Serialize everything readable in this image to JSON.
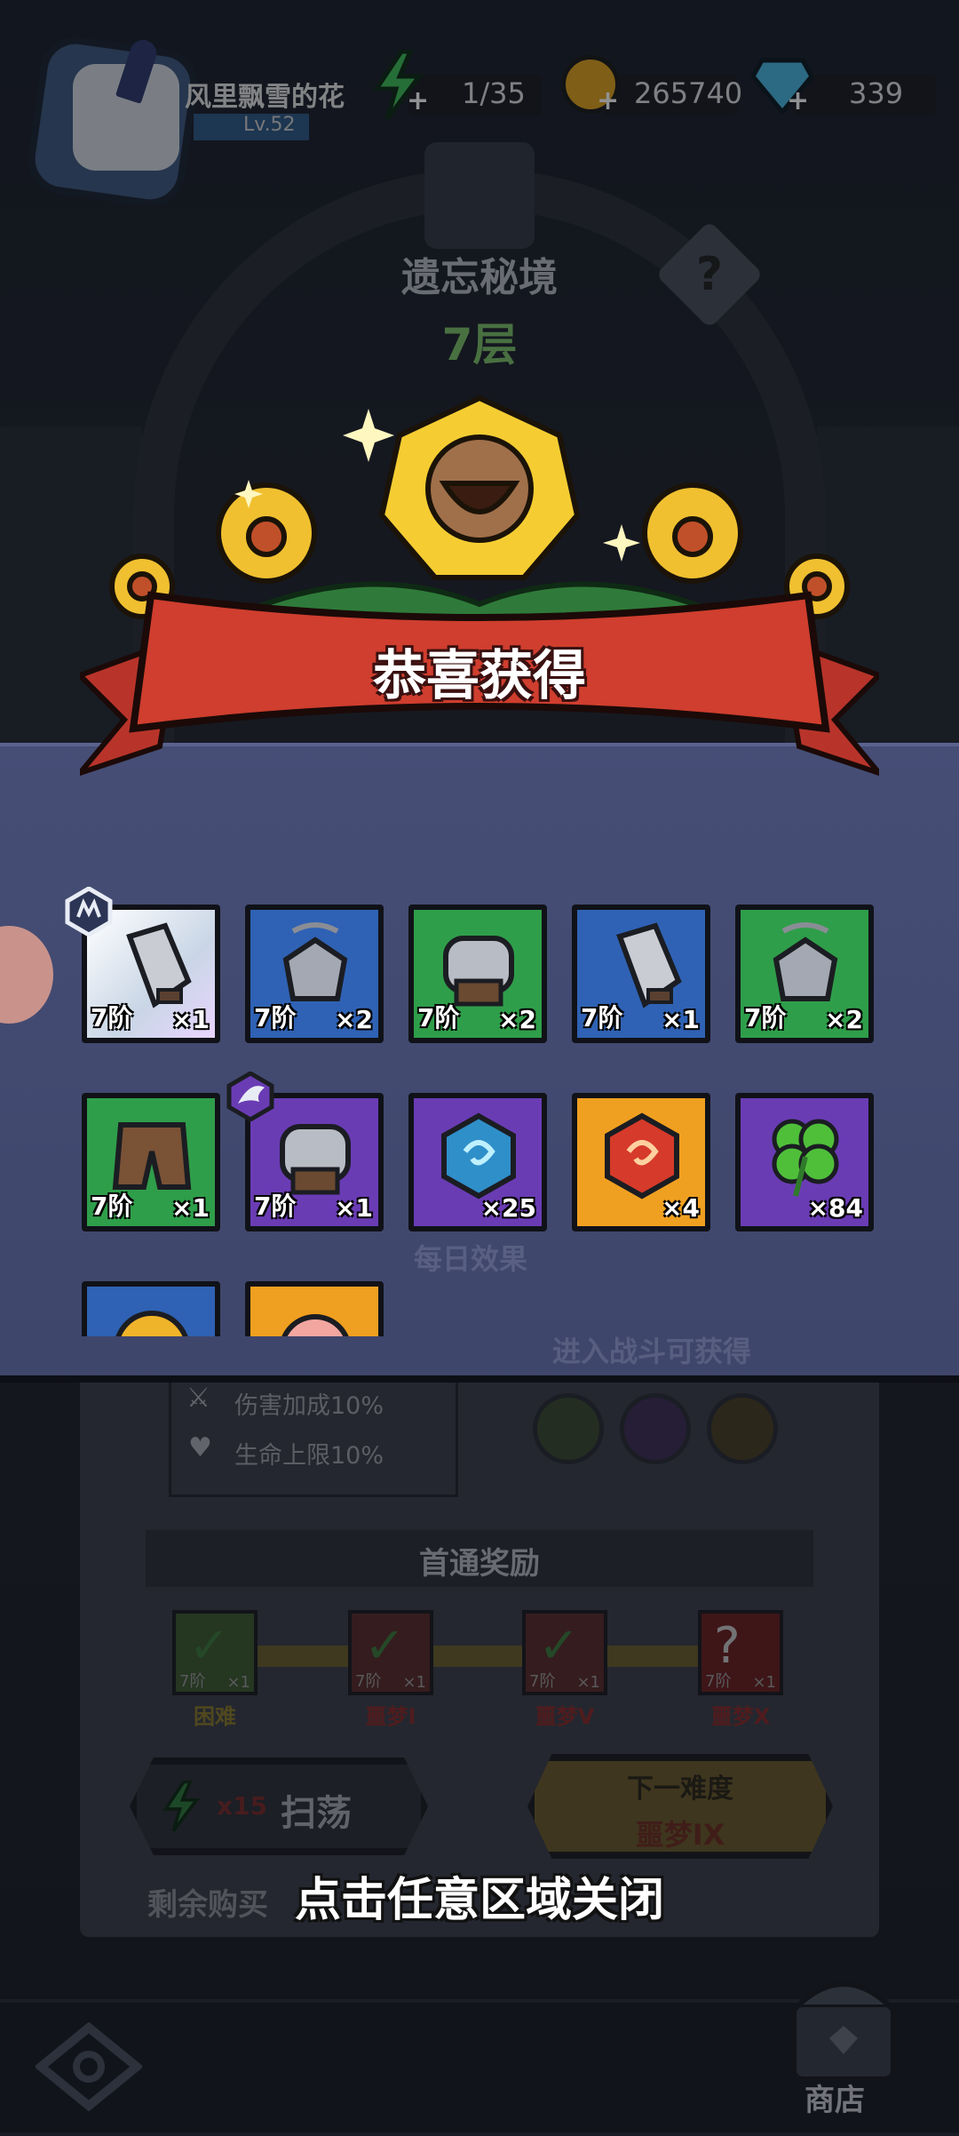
{
  "player": {
    "name": "风里飘雪的花",
    "level": "Lv.52"
  },
  "resources": {
    "energy": "1/35",
    "gold": "265740",
    "gems": "339"
  },
  "stage": {
    "title": "遗忘秘境",
    "floor": "7层",
    "help": "?"
  },
  "popup": {
    "title": "恭喜获得",
    "items": [
      {
        "icon": "sword-icon",
        "bg": "#d9e3ec",
        "tier": "7阶",
        "qty": "×1"
      },
      {
        "icon": "amulet-icon",
        "bg": "#2f62b4",
        "tier": "7阶",
        "qty": "×2"
      },
      {
        "icon": "armor-icon",
        "bg": "#2f9e4a",
        "tier": "7阶",
        "qty": "×2"
      },
      {
        "icon": "sword-icon",
        "bg": "#2f62b4",
        "tier": "7阶",
        "qty": "×1"
      },
      {
        "icon": "amulet-icon",
        "bg": "#2f9e4a",
        "tier": "7阶",
        "qty": "×2"
      },
      {
        "icon": "pants-icon",
        "bg": "#2f9e4a",
        "tier": "7阶",
        "qty": "×1"
      },
      {
        "icon": "armor-icon",
        "bg": "#6a3cb4",
        "tier": "7阶",
        "qty": "×1"
      },
      {
        "icon": "blue-gem-icon",
        "bg": "#6a3cb4",
        "tier": "",
        "qty": "×25"
      },
      {
        "icon": "red-gem-icon",
        "bg": "#f0a020",
        "tier": "",
        "qty": "×4"
      },
      {
        "icon": "clover-icon",
        "bg": "#6a3cb4",
        "tier": "",
        "qty": "×84"
      },
      {
        "icon": "coin-icon",
        "bg": "#2f62b4",
        "tier": "",
        "qty": ""
      },
      {
        "icon": "peach-icon",
        "bg": "#f0a020",
        "tier": "",
        "qty": ""
      }
    ],
    "close_hint": "点击任意区域关闭"
  },
  "background": {
    "daily_effect": "每日效果",
    "battle_unlock": "进入战斗可获得",
    "buff_damage": "伤害加成10%",
    "buff_hp": "生命上限10%",
    "first_clear": "首通奖励",
    "rewards": [
      {
        "label": "困难",
        "tier": "7阶",
        "qty": "×1",
        "color": "#8a7a2a",
        "nodebg": "#3c5a30"
      },
      {
        "label": "噩梦I",
        "tier": "7阶",
        "qty": "×1",
        "color": "#8a2a2a",
        "nodebg": "#5a2a2a"
      },
      {
        "label": "噩梦V",
        "tier": "7阶",
        "qty": "×1",
        "color": "#8a2a2a",
        "nodebg": "#5a2a2a"
      },
      {
        "label": "噩梦X",
        "tier": "7阶",
        "qty": "×1",
        "color": "#8a2a2a",
        "nodebg": "#6a2020"
      }
    ],
    "sweep_count": "x15",
    "sweep_label": "扫荡",
    "next_difficulty": "下一难度",
    "next_level": "噩梦IX",
    "remaining": "剩余购买",
    "shop": "商店"
  }
}
